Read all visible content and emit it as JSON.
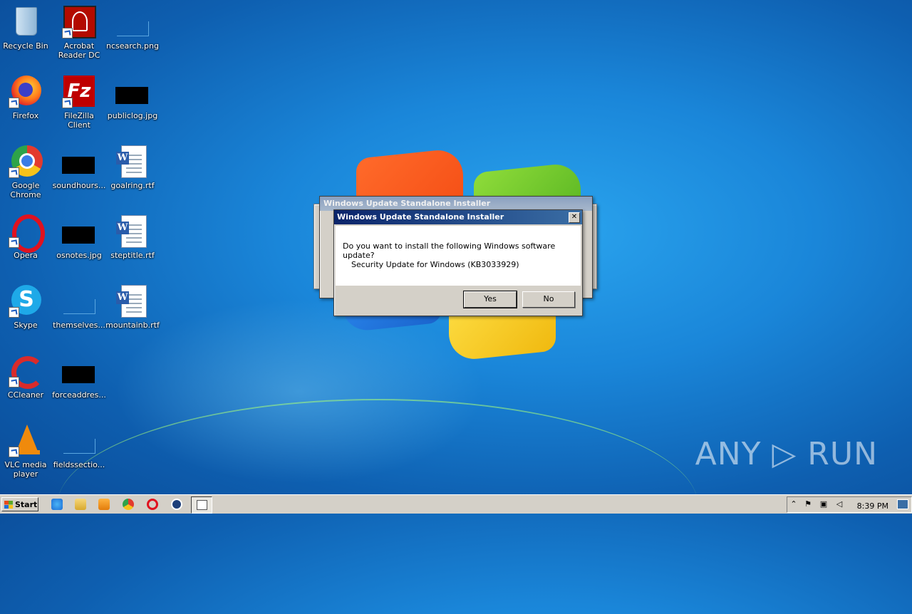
{
  "desktop": {
    "icons": [
      {
        "label": "Recycle Bin",
        "icon": "recycle-bin-icon"
      },
      {
        "label": "Acrobat Reader DC",
        "icon": "acrobat-icon"
      },
      {
        "label": "ncsearch.png",
        "icon": "png-file-icon"
      },
      {
        "label": "Firefox",
        "icon": "firefox-icon"
      },
      {
        "label": "FileZilla Client",
        "icon": "filezilla-icon"
      },
      {
        "label": "publiclog.jpg",
        "icon": "jpg-file-icon"
      },
      {
        "label": "Google Chrome",
        "icon": "chrome-icon"
      },
      {
        "label": "soundhours...",
        "icon": "file-icon"
      },
      {
        "label": "goalring.rtf",
        "icon": "word-doc-icon"
      },
      {
        "label": "Opera",
        "icon": "opera-icon"
      },
      {
        "label": "osnotes.jpg",
        "icon": "jpg-file-icon"
      },
      {
        "label": "steptitle.rtf",
        "icon": "word-doc-icon"
      },
      {
        "label": "Skype",
        "icon": "skype-icon"
      },
      {
        "label": "themselves...",
        "icon": "file-icon"
      },
      {
        "label": "mountainb.rtf",
        "icon": "word-doc-icon"
      },
      {
        "label": "CCleaner",
        "icon": "ccleaner-icon"
      },
      {
        "label": "forceaddres...",
        "icon": "file-icon"
      },
      {
        "label": "VLC media player",
        "icon": "vlc-icon"
      },
      {
        "label": "fieldssectio...",
        "icon": "file-icon"
      }
    ]
  },
  "background_dialog": {
    "title": "Windows Update Standalone Installer"
  },
  "dialog": {
    "title": "Windows Update Standalone Installer",
    "close": "✕",
    "question": "Do you want to install the following Windows software update?",
    "update_name": "Security Update for Windows (KB3033929)",
    "yes_label": "Yes",
    "no_label": "No"
  },
  "watermark": "ANY ▷ RUN",
  "taskbar": {
    "start_label": "Start",
    "clock": "8:39 PM",
    "tray_expand": "⌃",
    "quick_launch": [
      "ie-icon",
      "explorer-icon",
      "media-player-icon",
      "chrome-icon",
      "opera-icon",
      "anyrun-icon"
    ]
  },
  "colors": {
    "titlebar_active": "#0a246a",
    "desktop_blue": "#1a86d9",
    "dialog_face": "#d4d0c8"
  }
}
